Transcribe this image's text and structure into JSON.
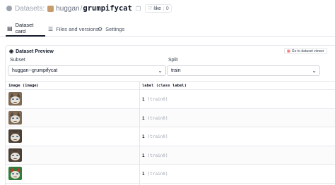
{
  "header": {
    "section_label": "Datasets:",
    "owner": "huggan",
    "separator": "/",
    "repo": "grumpifycat",
    "like_label": "like",
    "like_count": "0"
  },
  "tabs": [
    {
      "label": "Dataset card",
      "icon": "card-icon",
      "active": true
    },
    {
      "label": "Files and versions",
      "icon": "files-icon",
      "active": false
    },
    {
      "label": "Settings",
      "icon": "gear-icon",
      "active": false
    }
  ],
  "preview": {
    "title": "Dataset Preview",
    "viewer_button": "Go to dataset viewer",
    "subset_label": "Subset",
    "subset_value": "huggan--grumpifycat",
    "split_label": "Split",
    "split_value": "train"
  },
  "table": {
    "columns": [
      "image (image)",
      "label (class label)"
    ],
    "rows": [
      {
        "label": "1",
        "class": "(train0)"
      },
      {
        "label": "1",
        "class": "(train0)"
      },
      {
        "label": "1",
        "class": "(train0)"
      },
      {
        "label": "1",
        "class": "(train0)"
      },
      {
        "label": "1",
        "class": "(train0)"
      }
    ]
  }
}
